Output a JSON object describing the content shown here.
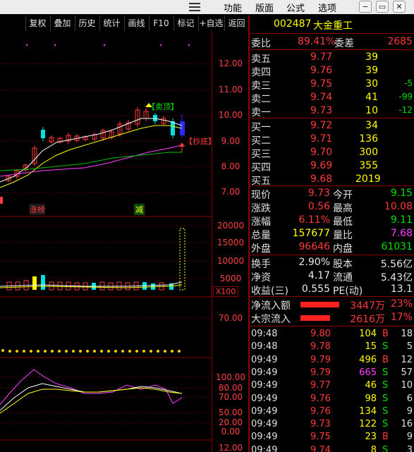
{
  "menu": {
    "items": [
      "功能",
      "版面",
      "公式",
      "选项"
    ],
    "window_buttons": [
      "−",
      "▭",
      "✕"
    ]
  },
  "toolbar": {
    "buttons": [
      "复权",
      "叠加",
      "历史",
      "统计",
      "画线",
      "F10",
      "标记",
      "+自选",
      "返回"
    ]
  },
  "chart": {
    "price_axis": [
      "12.00",
      "11.00",
      "10.00",
      "9.00",
      "8.00",
      "7.00"
    ],
    "volume_axis": [
      "20000",
      "15000",
      "10000",
      "5000"
    ],
    "volume_unit": "X100",
    "ind1_axis": [
      "70.00"
    ],
    "ind2_axis": [
      "100.00",
      "80.00",
      "70.00",
      "50.00",
      "20.00",
      "0.00"
    ],
    "bottom_axis": "12.00",
    "sell_signal": "【卖顶】",
    "buy_signal": "【抄底】",
    "tag_zhangbang": "涨榜",
    "tag_jian": "减",
    "colors": {
      "up": "#ff3a3a",
      "down": "#00e0e0",
      "ma1": "#ffffff",
      "ma2": "#ffff00",
      "ma3": "#ff40ff",
      "ma4": "#00c000"
    }
  },
  "quote": {
    "code": "002487",
    "name": "大金重工",
    "weibi_label": "委比",
    "weibi": "89.41%",
    "weicha_label": "委差",
    "weicha": "2685",
    "sell": [
      {
        "label": "卖五",
        "price": "9.77",
        "vol": "39",
        "chg": ""
      },
      {
        "label": "卖四",
        "price": "9.76",
        "vol": "39",
        "chg": ""
      },
      {
        "label": "卖三",
        "price": "9.75",
        "vol": "30",
        "chg": "-5"
      },
      {
        "label": "卖二",
        "price": "9.74",
        "vol": "41",
        "chg": "-99"
      },
      {
        "label": "卖一",
        "price": "9.73",
        "vol": "10",
        "chg": "-12"
      }
    ],
    "buy": [
      {
        "label": "买一",
        "price": "9.72",
        "vol": "34"
      },
      {
        "label": "买二",
        "price": "9.71",
        "vol": "136"
      },
      {
        "label": "买三",
        "price": "9.70",
        "vol": "300"
      },
      {
        "label": "买四",
        "price": "9.69",
        "vol": "355"
      },
      {
        "label": "买五",
        "price": "9.68",
        "vol": "2019"
      }
    ],
    "stats": [
      {
        "l1": "现价",
        "v1": "9.73",
        "c1": "red",
        "l2": "今开",
        "v2": "9.15",
        "c2": "green"
      },
      {
        "l1": "涨跌",
        "v1": "0.56",
        "c1": "red",
        "l2": "最高",
        "v2": "10.08",
        "c2": "red"
      },
      {
        "l1": "涨幅",
        "v1": "6.11%",
        "c1": "red",
        "l2": "最低",
        "v2": "9.11",
        "c2": "green"
      },
      {
        "l1": "总量",
        "v1": "157677",
        "c1": "yellow",
        "l2": "量比",
        "v2": "7.68",
        "c2": "magenta"
      },
      {
        "l1": "外盘",
        "v1": "96646",
        "c1": "red",
        "l2": "内盘",
        "v2": "61031",
        "c2": "green"
      }
    ],
    "fund": [
      {
        "l1": "换手",
        "v1": "2.90%",
        "l2": "股本",
        "v2": "5.56亿"
      },
      {
        "l1": "净资",
        "v1": "4.17",
        "l2": "流通",
        "v2": "5.43亿"
      },
      {
        "l1": "收益(三)",
        "v1": "0.555",
        "l2": "PE(动)",
        "v2": "13.1"
      }
    ],
    "flow": [
      {
        "label": "净流入额",
        "value": "3447万",
        "pct": "23%",
        "bar": 0.55
      },
      {
        "label": "大宗流入",
        "value": "2616万",
        "pct": "17%",
        "bar": 0.42
      }
    ],
    "ticks": [
      {
        "time": "09:48",
        "price": "9.80",
        "vol": "104",
        "bs": "B",
        "n": "18",
        "vc": "yellow"
      },
      {
        "time": "09:48",
        "price": "9.78",
        "vol": "15",
        "bs": "S",
        "n": "5",
        "vc": "yellow"
      },
      {
        "time": "09:49",
        "price": "9.79",
        "vol": "496",
        "bs": "B",
        "n": "12",
        "vc": "yellow"
      },
      {
        "time": "09:49",
        "price": "9.79",
        "vol": "665",
        "bs": "S",
        "n": "57",
        "vc": "magenta"
      },
      {
        "time": "09:49",
        "price": "9.77",
        "vol": "46",
        "bs": "S",
        "n": "10",
        "vc": "yellow"
      },
      {
        "time": "09:49",
        "price": "9.76",
        "vol": "98",
        "bs": "S",
        "n": "6",
        "vc": "yellow"
      },
      {
        "time": "09:49",
        "price": "9.76",
        "vol": "134",
        "bs": "S",
        "n": "9",
        "vc": "yellow"
      },
      {
        "time": "09:49",
        "price": "9.73",
        "vol": "122",
        "bs": "S",
        "n": "16",
        "vc": "yellow"
      },
      {
        "time": "09:49",
        "price": "9.75",
        "vol": "23",
        "bs": "B",
        "n": "9",
        "vc": "yellow"
      },
      {
        "time": "09:49",
        "price": "9.74",
        "vol": "8",
        "bs": "S",
        "n": "3",
        "vc": "yellow"
      }
    ]
  }
}
